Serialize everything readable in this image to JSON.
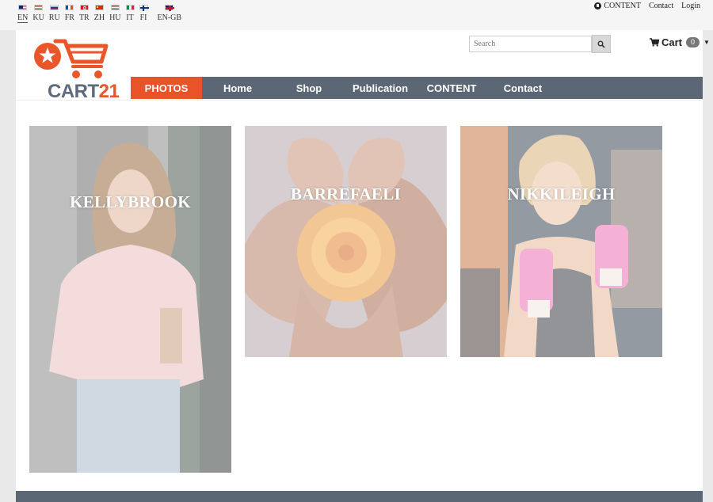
{
  "languages": [
    {
      "code": "EN",
      "flag_colors": [
        "#bf0a30",
        "#ffffff",
        "#002868"
      ]
    },
    {
      "code": "KU",
      "flag_colors": [
        "#ed2024",
        "#ffffff",
        "#278e43"
      ]
    },
    {
      "code": "RU",
      "flag_colors": [
        "#ffffff",
        "#0039a6",
        "#d52b1e"
      ]
    },
    {
      "code": "FR",
      "flag_colors": [
        "#0055a4",
        "#ffffff",
        "#ef4135"
      ]
    },
    {
      "code": "TR",
      "flag_colors": [
        "#e30a17",
        "#e30a17",
        "#e30a17"
      ]
    },
    {
      "code": "ZH",
      "flag_colors": [
        "#de2910",
        "#de2910",
        "#de2910"
      ]
    },
    {
      "code": "HU",
      "flag_colors": [
        "#ce2939",
        "#ffffff",
        "#477050"
      ]
    },
    {
      "code": "IT",
      "flag_colors": [
        "#009246",
        "#ffffff",
        "#ce2b37"
      ]
    },
    {
      "code": "FI",
      "flag_colors": [
        "#ffffff",
        "#003580",
        "#ffffff"
      ]
    },
    {
      "code": "EN-GB",
      "flag_colors": [
        "#012169",
        "#c8102e",
        "#ffffff"
      ]
    }
  ],
  "top_links": {
    "content": "CONTENT",
    "contact": "Contact",
    "login": "Login"
  },
  "logo": {
    "word": "CART",
    "number": "21",
    "brand_color": "#e8562a",
    "text_color": "#5c6a7a"
  },
  "search": {
    "placeholder": "Search"
  },
  "cart": {
    "label": "Cart",
    "count": "0"
  },
  "nav": {
    "items": [
      "PHOTOS",
      "Home",
      "Shop",
      "Publication",
      "CONTENT",
      "Contact"
    ],
    "active_color": "#e9532a",
    "bar_color": "#5b6774"
  },
  "cards": [
    {
      "title": "KELLYBROOK"
    },
    {
      "title": "BARREFAELI"
    },
    {
      "title": "NIKKILEIGH"
    }
  ]
}
